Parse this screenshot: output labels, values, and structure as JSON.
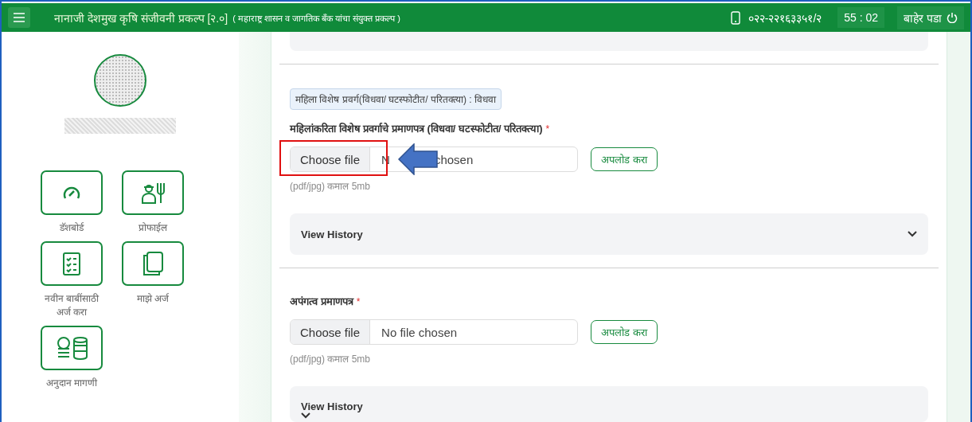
{
  "header": {
    "title": "नानाजी देशमुख कृषि संजीवनी प्रकल्प [२.०]",
    "subtitle": "( महाराष्ट्र शासन व जागतिक बँक यांचा संयुक्त प्रकल्प )",
    "phone": "०२२-२२१६३३५१/२",
    "timer": "55 : 02",
    "logout": "बाहेर पडा"
  },
  "sidebar": {
    "nav": [
      {
        "kind": "dashboard",
        "label": "डॅशबोर्ड"
      },
      {
        "kind": "profile",
        "label": "प्रोफाईल"
      },
      {
        "kind": "apply",
        "label": "नवीन बाबींसाठी अर्ज करा"
      },
      {
        "kind": "applications",
        "label": "माझे अर्ज"
      },
      {
        "kind": "grant",
        "label": "अनुदान मागणी"
      }
    ]
  },
  "sections": [
    {
      "badge": "महिला विशेष प्रवर्ग(विधवा/ घटस्फोटीत/ परितक्त्या) : विधवा",
      "label": "महिलांकरिता विशेष प्रवर्गाचे प्रमाणपत्र (विधवा/ घटस्फोटीत/ परितक्त्या)",
      "required_mark": "*",
      "file_button": "Choose file",
      "file_status": [
        "N",
        "chosen"
      ],
      "upload": "अपलोड करा",
      "hint": "(pdf/jpg) कमाल 5mb",
      "history": {
        "label": "View History",
        "expanded": false,
        "kind": "inline"
      },
      "annotations": {
        "highlight_box": true,
        "arrow": true
      }
    },
    {
      "label": "अपंगत्व प्रमाणपत्र",
      "required_mark": "*",
      "file_button": "Choose file",
      "file_status": [
        "No file chosen"
      ],
      "upload": "अपलोड करा",
      "hint": "(pdf/jpg) कमाल 5mb",
      "history": {
        "label": "View History",
        "expanded": false,
        "kind": "stacked"
      }
    }
  ]
}
